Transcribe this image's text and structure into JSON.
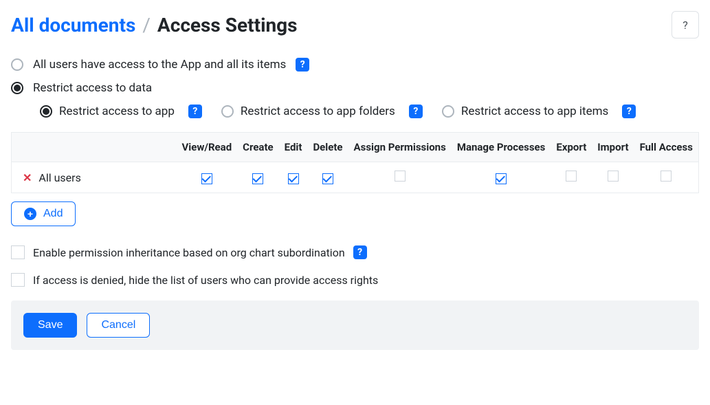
{
  "breadcrumb": {
    "link": "All documents",
    "sep": "/",
    "current": "Access Settings"
  },
  "top_options": {
    "all_users": "All users have access to the App and all its items",
    "restrict": "Restrict access to data"
  },
  "sub_options": {
    "app": "Restrict access to app",
    "folders": "Restrict access to app folders",
    "items": "Restrict access to app items"
  },
  "table": {
    "headers": [
      "View/Read",
      "Create",
      "Edit",
      "Delete",
      "Assign Permissions",
      "Manage Processes",
      "Export",
      "Import",
      "Full Access"
    ],
    "rows": [
      {
        "label": "All users",
        "checks": [
          true,
          true,
          true,
          true,
          false,
          true,
          false,
          false,
          false
        ]
      }
    ]
  },
  "add_label": "Add",
  "checkboxes": {
    "inherit": "Enable permission inheritance based on org chart subordination",
    "hide_denied": "If access is denied, hide the list of users who can provide access rights"
  },
  "buttons": {
    "save": "Save",
    "cancel": "Cancel"
  },
  "icons": {
    "help": "?",
    "plus": "+",
    "x": "✕"
  }
}
